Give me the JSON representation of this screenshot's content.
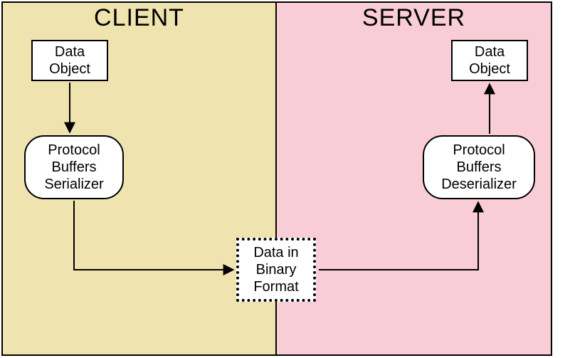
{
  "client": {
    "title": "CLIENT",
    "data_object": "Data\nObject",
    "serializer": "Protocol\nBuffers\nSerializer"
  },
  "server": {
    "title": "SERVER",
    "data_object": "Data\nObject",
    "deserializer": "Protocol\nBuffers\nDeserializer"
  },
  "binary": "Data in\nBinary\nFormat"
}
